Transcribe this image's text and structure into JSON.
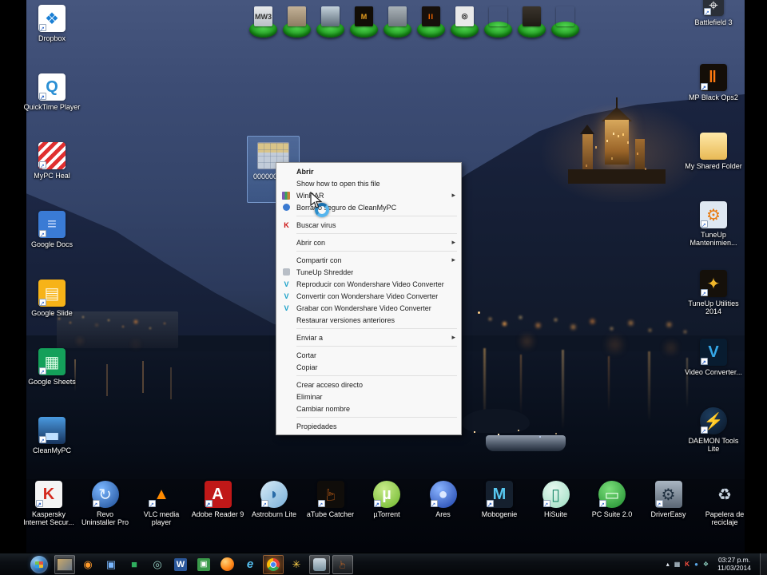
{
  "desktop": {
    "top_chips": [
      {
        "id": "g1",
        "emblem": "MW3"
      },
      {
        "id": "g2",
        "emblem": ""
      },
      {
        "id": "g3",
        "emblem": ""
      },
      {
        "id": "g4",
        "emblem": "M"
      },
      {
        "id": "g5",
        "emblem": ""
      },
      {
        "id": "g6",
        "emblem": "II"
      },
      {
        "id": "g7",
        "emblem": "◎"
      },
      {
        "id": "g8",
        "emblem": ""
      },
      {
        "id": "g9",
        "emblem": ""
      },
      {
        "id": "g10",
        "emblem": ""
      }
    ],
    "left_icons": [
      {
        "label": "Dropbox",
        "icon": "i-dropbox",
        "glyph": "❖",
        "shortcut": true
      },
      {
        "label": "QuickTime Player",
        "icon": "i-quicktime",
        "glyph": "Q",
        "shortcut": true
      },
      {
        "label": "MyPC Heal",
        "icon": "i-stripes",
        "glyph": "",
        "shortcut": true
      },
      {
        "label": "Google Docs",
        "icon": "i-gdocs",
        "glyph": "≡",
        "shortcut": true
      },
      {
        "label": "Google Slide",
        "icon": "i-gslides",
        "glyph": "▤",
        "shortcut": true
      },
      {
        "label": "Google Sheets",
        "icon": "i-gsheets",
        "glyph": "▦",
        "shortcut": true
      },
      {
        "label": "CleanMyPC",
        "icon": "i-cleanmypc",
        "glyph": "▃",
        "shortcut": true
      }
    ],
    "right_icons": [
      {
        "label": "Battlefield 3",
        "icon": "i-bf",
        "glyph": "⌖",
        "shortcut": true
      },
      {
        "label": "MP Black Ops2",
        "icon": "i-bo2",
        "glyph": "‖",
        "shortcut": true
      },
      {
        "label": "My Shared Folder",
        "icon": "i-folder",
        "glyph": "",
        "shortcut": false
      },
      {
        "label": "TuneUp Mantenimien...",
        "icon": "i-tuneup-m",
        "glyph": "⚙",
        "shortcut": true
      },
      {
        "label": "TuneUp Utilities 2014",
        "icon": "i-tuneup-u",
        "glyph": "✦",
        "shortcut": true
      },
      {
        "label": "Video Converter...",
        "icon": "i-vconv",
        "glyph": "V",
        "shortcut": true
      },
      {
        "label": "DAEMON Tools Lite",
        "icon": "i-daemon",
        "glyph": "⚡",
        "shortcut": true
      }
    ],
    "bottom_icons": [
      {
        "label": "Kaspersky Internet Secur...",
        "icon": "i-kasp",
        "glyph": "K",
        "shortcut": true
      },
      {
        "label": "Revo Uninstaller Pro",
        "icon": "i-revo",
        "glyph": "↻",
        "shortcut": true
      },
      {
        "label": "VLC media player",
        "icon": "i-vlc",
        "glyph": "▲",
        "shortcut": true
      },
      {
        "label": "Adobe Reader 9",
        "icon": "i-adobe",
        "glyph": "A",
        "shortcut": true
      },
      {
        "label": "Astroburn Lite",
        "icon": "i-astro",
        "glyph": "◗",
        "shortcut": true
      },
      {
        "label": "aTube Catcher",
        "icon": "i-atube",
        "glyph": "☞",
        "shortcut": true
      },
      {
        "label": "µTorrent",
        "icon": "i-utor",
        "glyph": "µ",
        "shortcut": true
      },
      {
        "label": "Ares",
        "icon": "i-ares",
        "glyph": "●",
        "shortcut": true
      },
      {
        "label": "Mobogenie",
        "icon": "i-mobo",
        "glyph": "M",
        "shortcut": true
      },
      {
        "label": "HiSuite",
        "icon": "i-hisuite",
        "glyph": "▯",
        "shortcut": true
      },
      {
        "label": "PC Suite 2.0",
        "icon": "i-pcsuite",
        "glyph": "▭",
        "shortcut": true
      },
      {
        "label": "DriverEasy",
        "icon": "i-deasy",
        "glyph": "⚙",
        "shortcut": true
      },
      {
        "label": "Papelera de reciclaje",
        "icon": "i-recycle",
        "glyph": "♻",
        "shortcut": false
      }
    ],
    "selected_file": {
      "label": "0000000000"
    }
  },
  "context_menu": {
    "items": [
      {
        "label": "Abrir",
        "bold": true
      },
      {
        "label": "Show how to open this file"
      },
      {
        "label": "WinRAR",
        "icon": "ic-winrar",
        "arrow": true
      },
      {
        "label": "Borrado seguro de CleanMyPC",
        "icon": "ic-clean"
      },
      {
        "separator": true
      },
      {
        "label": "Buscar virus",
        "icon": "ic-kasp",
        "glyph": "K"
      },
      {
        "separator": true
      },
      {
        "label": "Abrir con",
        "arrow": true
      },
      {
        "separator": true
      },
      {
        "label": "Compartir con",
        "arrow": true
      },
      {
        "label": "TuneUp Shredder",
        "icon": "ic-tune"
      },
      {
        "label": "Reproducir con Wondershare Video Converter",
        "icon": "ic-wond",
        "glyph": "V"
      },
      {
        "label": "Convertir con Wondershare Video Converter",
        "icon": "ic-wond",
        "glyph": "V"
      },
      {
        "label": "Grabar con Wondershare Video Converter",
        "icon": "ic-wond",
        "glyph": "V"
      },
      {
        "label": "Restaurar versiones anteriores"
      },
      {
        "separator": true
      },
      {
        "label": "Enviar a",
        "arrow": true
      },
      {
        "separator": true
      },
      {
        "label": "Cortar"
      },
      {
        "label": "Copiar"
      },
      {
        "separator": true
      },
      {
        "label": "Crear acceso directo"
      },
      {
        "label": "Eliminar"
      },
      {
        "label": "Cambiar nombre"
      },
      {
        "separator": true
      },
      {
        "label": "Propiedades"
      }
    ]
  },
  "taskbar": {
    "items": [
      {
        "name": "explorer-window",
        "icon": "tbi-tile",
        "glyph": "",
        "active": true
      },
      {
        "name": "media-player",
        "icon": "tbi-wmp",
        "glyph": "◉"
      },
      {
        "name": "messenger",
        "icon": "tbi-msg",
        "glyph": "▣"
      },
      {
        "name": "green-app",
        "icon": "tbi-green",
        "glyph": "■"
      },
      {
        "name": "swirl-app",
        "icon": "tbi-swirl",
        "glyph": "◎"
      },
      {
        "name": "word",
        "icon": "tbi-word",
        "glyph": "W"
      },
      {
        "name": "photo-app",
        "icon": "tbi-photo",
        "glyph": "▣"
      },
      {
        "name": "firefox",
        "icon": "tbi-ff",
        "glyph": ""
      },
      {
        "name": "internet-explorer",
        "icon": "tbi-ie",
        "glyph": "e"
      },
      {
        "name": "chrome",
        "icon": "tbi-chrome",
        "glyph": "",
        "glow": true
      },
      {
        "name": "tuneup",
        "icon": "tbi-tuneup",
        "glyph": "✳"
      },
      {
        "name": "gray-app",
        "icon": "tbi-gray",
        "glyph": "",
        "active": true
      },
      {
        "name": "atube-catcher",
        "icon": "tbi-atube",
        "glyph": "☞",
        "active": true
      }
    ],
    "tray": [
      {
        "name": "hidden-icons",
        "icon": "tri-arrow",
        "glyph": "▴"
      },
      {
        "name": "tray-app-1",
        "icon": "tri-a",
        "glyph": "▦"
      },
      {
        "name": "kaspersky-tray",
        "icon": "tri-k",
        "glyph": "K"
      },
      {
        "name": "tray-app-2",
        "icon": "tri-b",
        "glyph": "●"
      },
      {
        "name": "tray-app-3",
        "icon": "tri-c",
        "glyph": "❖"
      }
    ],
    "clock": {
      "time": "03:27 p.m.",
      "date": "11/03/2014"
    }
  },
  "colors": {
    "selection": "#77adde",
    "menu_bg": "#f8f8f8",
    "taskbar_bg": "#0b0f14",
    "chip_green": "#2eb82e",
    "light_warm": "#ffb85e"
  }
}
